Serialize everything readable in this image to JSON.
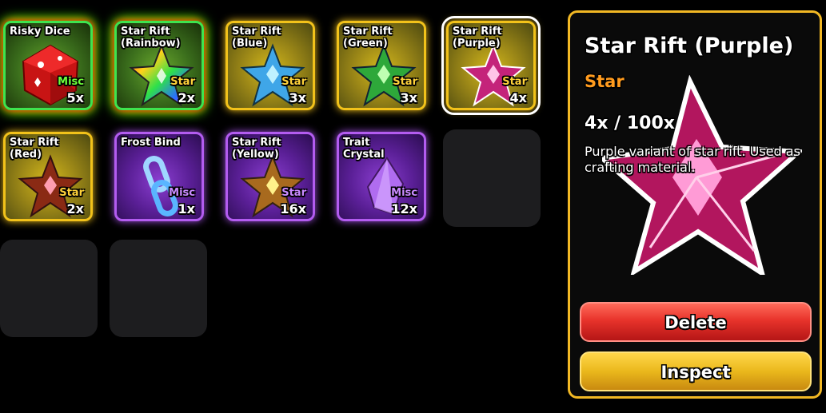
{
  "inventory": [
    {
      "name": "Risky Dice",
      "type": "Misc",
      "count": "5x",
      "type_color": "#6dff3a"
    },
    {
      "name": "Star Rift\n(Rainbow)",
      "type": "Star",
      "count": "2x",
      "type_color": "#ffd23a"
    },
    {
      "name": "Star Rift\n(Blue)",
      "type": "Star",
      "count": "3x",
      "type_color": "#ffd23a"
    },
    {
      "name": "Star Rift\n(Green)",
      "type": "Star",
      "count": "3x",
      "type_color": "#ffd23a"
    },
    {
      "name": "Star Rift\n(Purple)",
      "type": "Star",
      "count": "4x",
      "type_color": "#ffd23a"
    },
    {
      "name": "Star Rift\n(Red)",
      "type": "Star",
      "count": "2x",
      "type_color": "#ffd23a"
    },
    {
      "name": "Frost Bind",
      "type": "Misc",
      "count": "1x",
      "type_color": "#c98bff"
    },
    {
      "name": "Star Rift\n(Yellow)",
      "type": "Star",
      "count": "16x",
      "type_color": "#c98bff"
    },
    {
      "name": "Trait\nCrystal",
      "type": "Misc",
      "count": "12x",
      "type_color": "#c98bff"
    }
  ],
  "detail": {
    "title": "Star Rift (Purple)",
    "category": "Star",
    "quantity": "4x / 100x",
    "description": "Purple variant of star rift. Used as crafting material.",
    "delete_label": "Delete",
    "inspect_label": "Inspect"
  },
  "colors": {
    "accent_gold": "#f2b824",
    "category_orange": "#ff9b1e",
    "delete_red": "#e8332b",
    "inspect_yellow": "#eab81c"
  }
}
